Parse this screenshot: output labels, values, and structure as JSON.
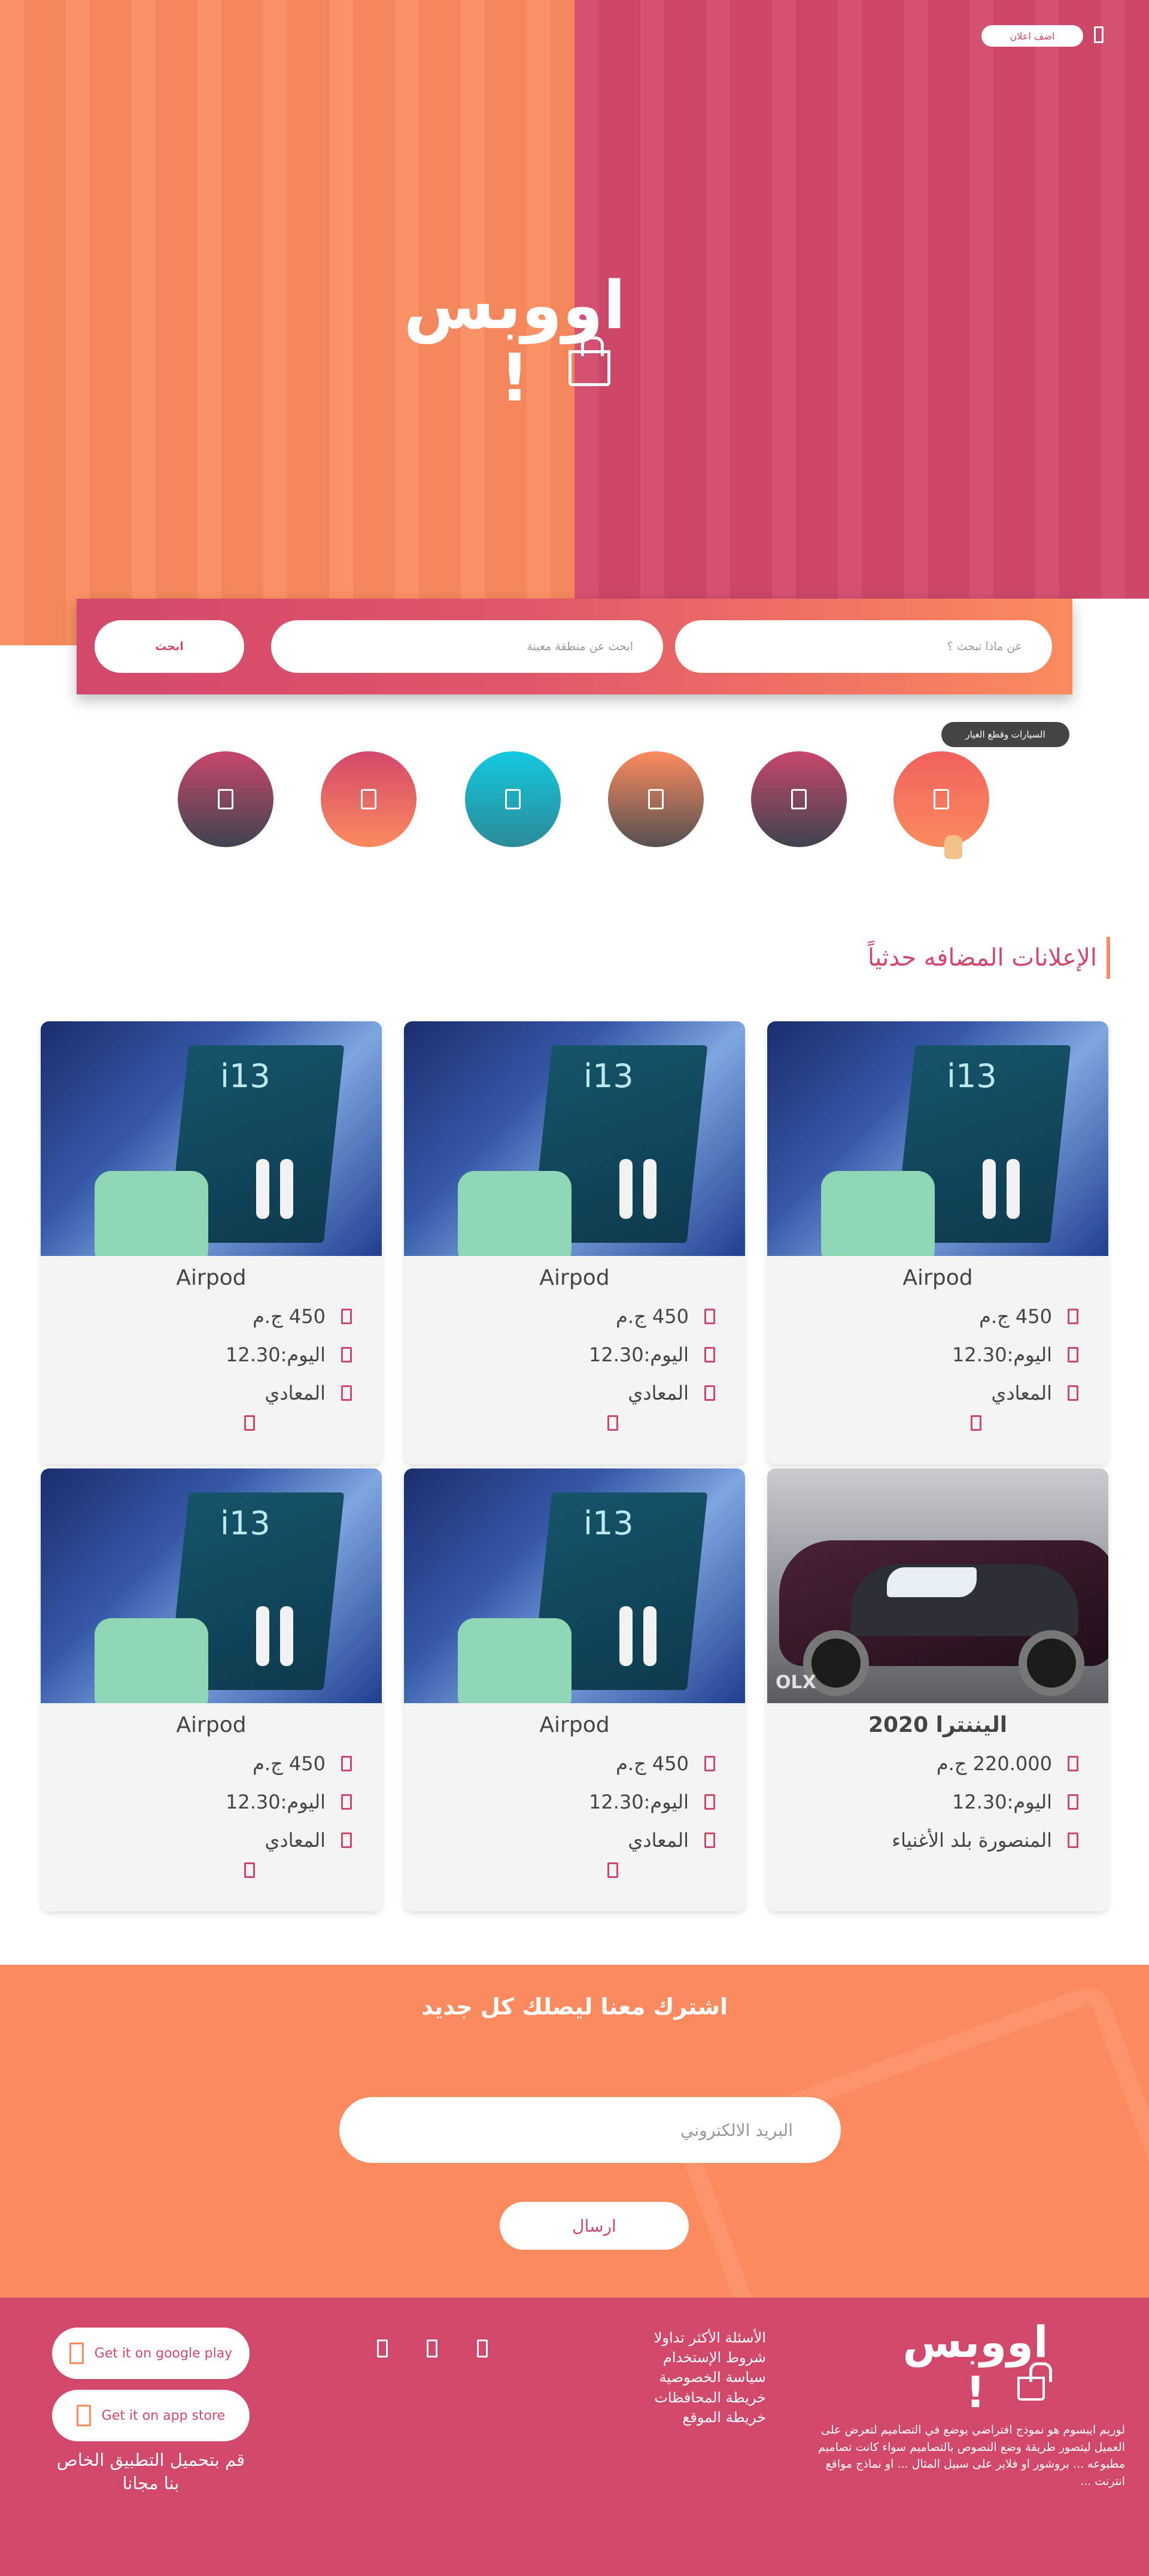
{
  "header": {
    "add_ad_label": "اضف اعلان",
    "logo_text": "اووبس !"
  },
  "search": {
    "what_placeholder": "عن ماذا تبحث ؟",
    "area_placeholder": "ابحث عن منطقة معينة",
    "button_label": "ابحث"
  },
  "categories": {
    "tooltip": "السيارات وقطع الغيار"
  },
  "section": {
    "title": "الإعلانات المضافه حدثياً"
  },
  "cards": [
    {
      "title": "Airpod",
      "price": "450  ج.م",
      "time": "اليوم:12.30",
      "location": "المعادي"
    },
    {
      "title": "Airpod",
      "price": "450  ج.م",
      "time": "اليوم:12.30",
      "location": "المعادي"
    },
    {
      "title": "Airpod",
      "price": "450  ج.م",
      "time": "اليوم:12.30",
      "location": "المعادي"
    },
    {
      "title": "اليننترا 2020",
      "price": "220.000  ج.م",
      "time": "اليوم:12.30",
      "location": "المنصورة بلد الأغنياء"
    },
    {
      "title": "Airpod",
      "price": "450  ج.م",
      "time": "اليوم:12.30",
      "location": "المعادي"
    },
    {
      "title": "Airpod",
      "price": "450  ج.م",
      "time": "اليوم:12.30",
      "location": "المعادي"
    }
  ],
  "newsletter": {
    "title": "اشترك معنا ليصلك كل جديد",
    "email_placeholder": "البريد الالكتروني",
    "send_label": "ارسال"
  },
  "footer": {
    "google_play": "Get it on google play",
    "app_store": "Get it on app store",
    "app_text": "قم بتحميل التطبيق الخاص بنا مجانا",
    "links": [
      "الأسئلة الأكثر تداولا",
      "شروط الإستخدام",
      "سياسة الخصوصية",
      "خريطة المحافظات",
      "خريطة الموقع"
    ],
    "logo_text": "اووبس !",
    "description": "لوريم ايبسوم هو نموذج افتراضي يوضع في التصاميم لتعرض على العميل ليتصور طريقة وضع النصوص بالتصاميم سواء كانت تصاميم مطبوعه ... بروشور او فلاير على سبيل المثال ... او نماذج مواقع انترنت ..."
  },
  "colors": {
    "accent_red": "#d2486a",
    "accent_orange": "#fb8b5e"
  }
}
